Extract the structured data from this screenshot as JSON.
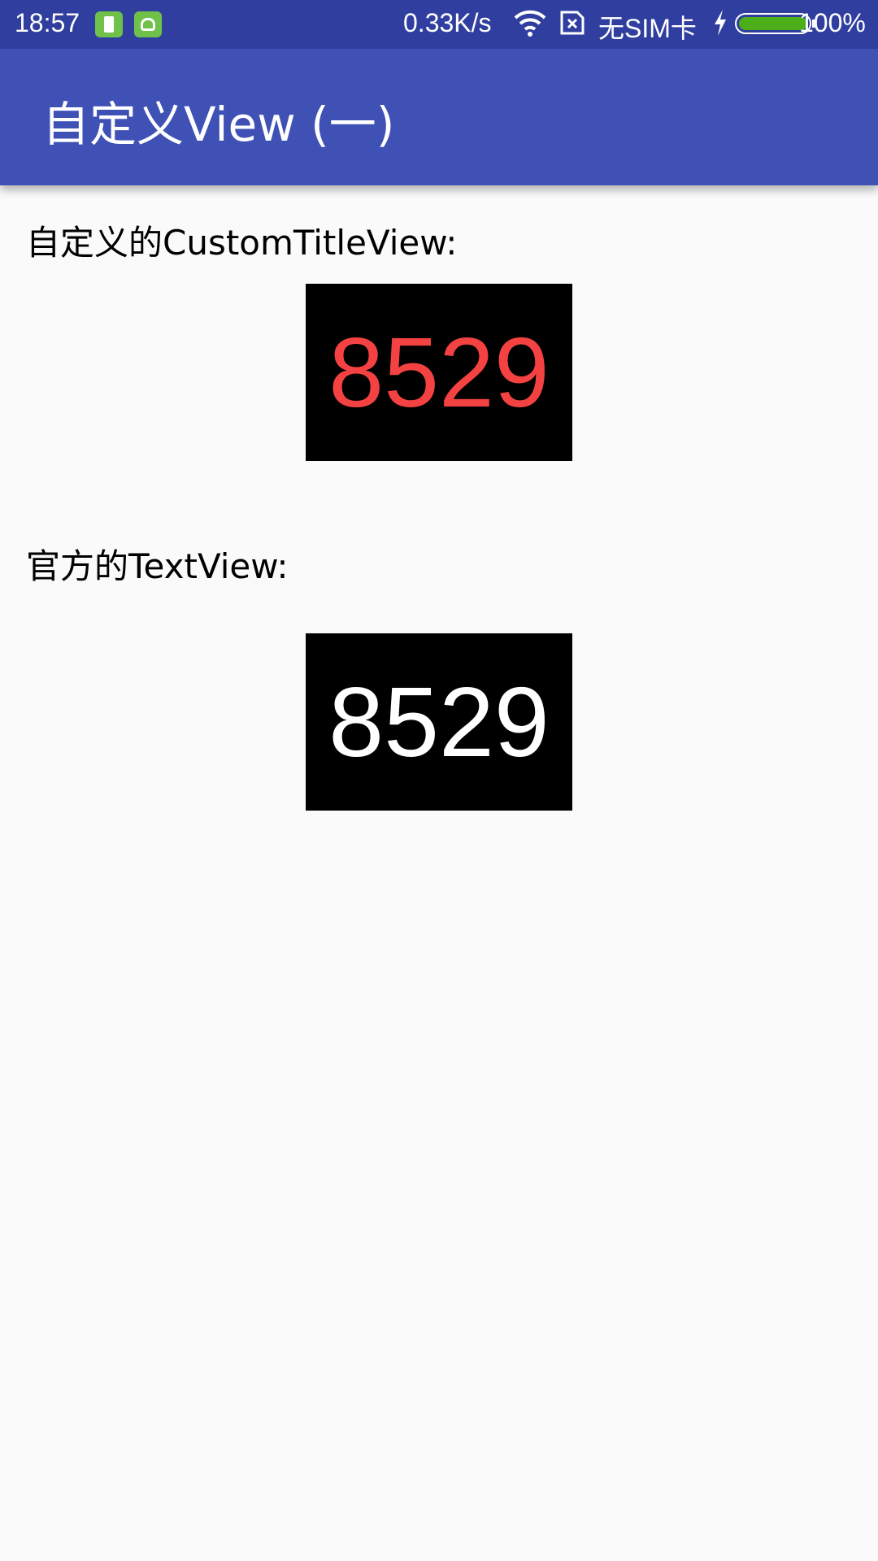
{
  "status_bar": {
    "time": "18:57",
    "net_speed": "0.33K/s",
    "carrier": "无SIM卡",
    "battery_percent_text": "100%",
    "battery_level": 1.0,
    "icons": [
      "battery-app-icon",
      "android-app-icon",
      "wifi-icon",
      "sim-card-icon",
      "charging-bolt-icon",
      "battery-icon"
    ]
  },
  "app_bar": {
    "title": "自定义View (一)",
    "color": "#3f51b5",
    "status_color": "#303f9f"
  },
  "content": {
    "custom_label": "自定义的CustomTitleView:",
    "custom_value": "8529",
    "custom_value_color": "#f44242",
    "official_label": "官方的TextView:",
    "official_value": "8529",
    "official_value_color": "#ffffff",
    "box_color": "#000000"
  }
}
